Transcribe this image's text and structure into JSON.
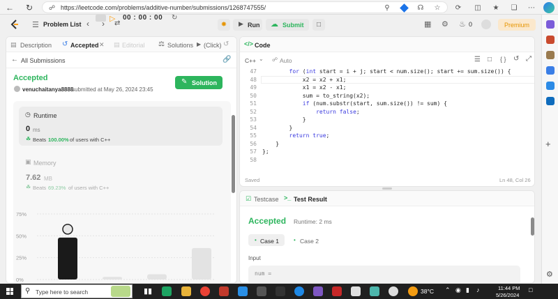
{
  "browser": {
    "url": "https://leetcode.com/problems/additive-number/submissions/1268747555/"
  },
  "navbar": {
    "problem_list": "Problem List",
    "timer": "00 : 00 : 00",
    "run": "Run",
    "submit": "Submit",
    "streak": "0",
    "premium": "Premium"
  },
  "left_tabs": {
    "description": "Description",
    "accepted": "Accepted",
    "editorial": "Editorial",
    "solutions": "Solutions",
    "click": "(Click)"
  },
  "all_submissions": "All Submissions",
  "submission": {
    "status": "Accepted",
    "user": "venuchaitanya8888",
    "submitted": "submitted at May 26, 2024 23:45",
    "solution_btn": "Solution"
  },
  "runtime": {
    "label": "Runtime",
    "value": "0",
    "unit": "ms",
    "beats_prefix": "Beats",
    "beats_pct": "100.00%",
    "beats_suffix": "of users with C++"
  },
  "memory": {
    "label": "Memory",
    "value": "7.62",
    "unit": "MB",
    "beats_prefix": "Beats",
    "beats_pct": "69.23%",
    "beats_suffix": "of users with C++"
  },
  "chart_data": {
    "type": "bar",
    "yticks": [
      "75%",
      "50%",
      "25%",
      "0%"
    ],
    "ylim": [
      0,
      75
    ],
    "values": [
      48,
      3,
      6,
      36
    ],
    "highlight_index": 0
  },
  "code_panel": {
    "title": "Code",
    "lang": "C++",
    "mode": "Auto",
    "saved": "Saved",
    "cursor": "Ln 48, Col 26"
  },
  "code_lines": [
    {
      "n": "47",
      "t": "        for (int start = i + j; start < num.size(); start += sum.size()) {"
    },
    {
      "n": "48",
      "t": "            x2 = x2 + x1;"
    },
    {
      "n": "49",
      "t": "            x1 = x2 - x1;"
    },
    {
      "n": "50",
      "t": "            sum = to_string(x2);"
    },
    {
      "n": "51",
      "t": "            if (num.substr(start, sum.size()) != sum) {"
    },
    {
      "n": "52",
      "t": "                return false;"
    },
    {
      "n": "53",
      "t": "            }"
    },
    {
      "n": "54",
      "t": "        }"
    },
    {
      "n": "55",
      "t": "        return true;"
    },
    {
      "n": "56",
      "t": "    }"
    },
    {
      "n": "57",
      "t": "};"
    },
    {
      "n": "58",
      "t": ""
    }
  ],
  "result_panel": {
    "testcase_tab": "Testcase",
    "result_tab": "Test Result",
    "status": "Accepted",
    "runtime": "Runtime: 2 ms",
    "case1": "Case 1",
    "case2": "Case 2",
    "input_label": "Input",
    "input_value": "num ="
  },
  "taskbar": {
    "search_placeholder": "Type here to search",
    "temp": "38°C",
    "time": "11:44 PM",
    "date": "5/26/2024"
  },
  "colors": {
    "accepted_green": "#2db55d",
    "leetcode_orange": "#ffa116",
    "submit_green": "#2db55d"
  }
}
